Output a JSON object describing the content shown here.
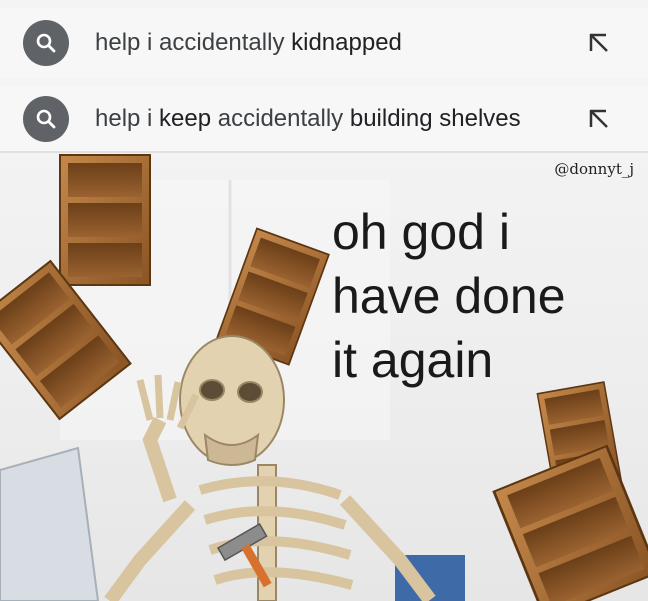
{
  "suggestions": [
    {
      "prefix": "help i accidentally ",
      "completion": "kidnapped"
    },
    {
      "prefix": "help i ",
      "completion": "keep",
      "middle": " accidentally ",
      "tail": "building shelves"
    }
  ],
  "credit": "@donnyt_j",
  "caption_lines": [
    "oh god i",
    "have done",
    "it again"
  ],
  "icons": {
    "search": "search-icon",
    "fill_query": "arrow-up-left-icon"
  },
  "colors": {
    "icon_bg": "#5f6368",
    "wood": "#a56a35",
    "bone": "#e3d2b0"
  }
}
